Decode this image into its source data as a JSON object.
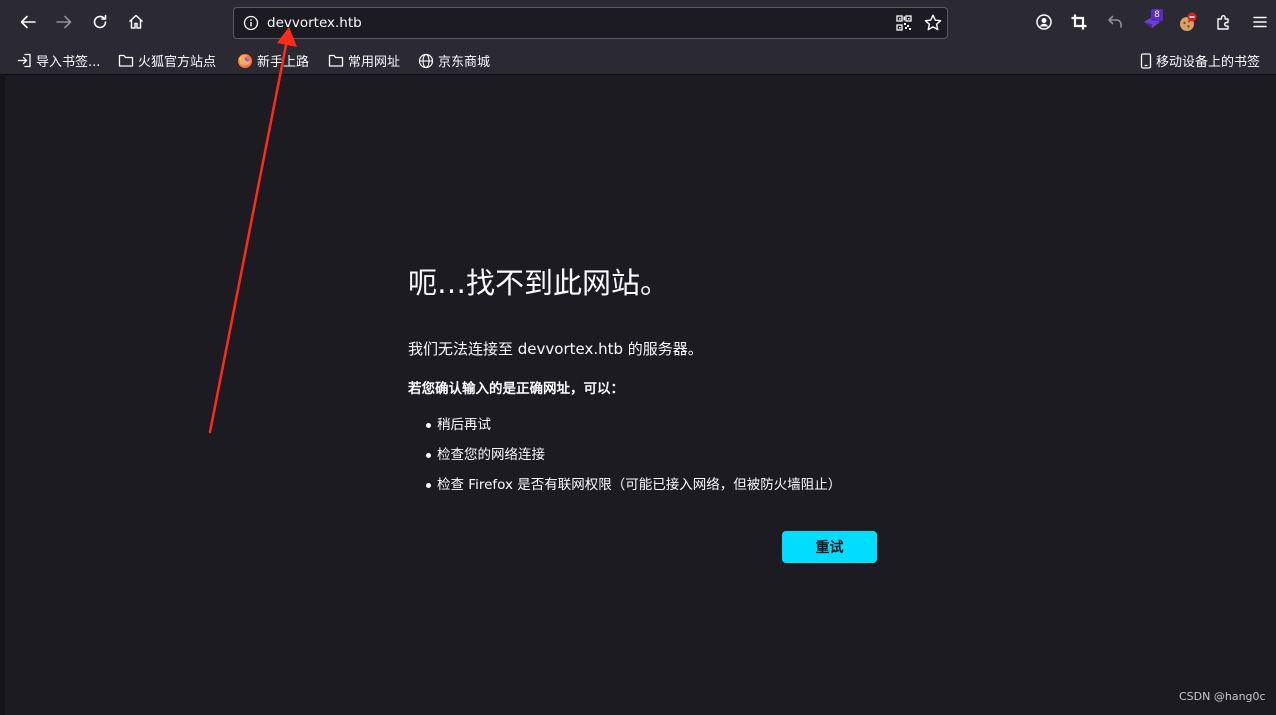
{
  "address_bar": {
    "url": "devvortex.htb"
  },
  "extensions": {
    "badge_count": "8"
  },
  "bookmarks": [
    {
      "label": "导入书签...",
      "icon": "import-icon"
    },
    {
      "label": "火狐官方站点",
      "icon": "folder-icon"
    },
    {
      "label": "新手上路",
      "icon": "firefox-icon"
    },
    {
      "label": "常用网址",
      "icon": "folder-icon"
    },
    {
      "label": "京东商城",
      "icon": "globe-icon"
    }
  ],
  "mobile_bookmarks": {
    "label": "移动设备上的书签",
    "icon": "mobile-icon"
  },
  "error": {
    "title": "呃…找不到此网站。",
    "description": "我们无法连接至 devvortex.htb 的服务器。",
    "hint": "若您确认输入的是正确网址，可以：",
    "tips": [
      "稍后再试",
      "检查您的网络连接",
      "检查 Firefox 是否有联网权限（可能已接入网络，但被防火墙阻止）"
    ],
    "retry_label": "重试"
  },
  "watermark": "CSDN @hang0c",
  "colors": {
    "accent": "#00ddff",
    "background": "#1c1b22",
    "toolbar": "#2b2a33",
    "annotation_arrow": "#ff2a1a"
  }
}
